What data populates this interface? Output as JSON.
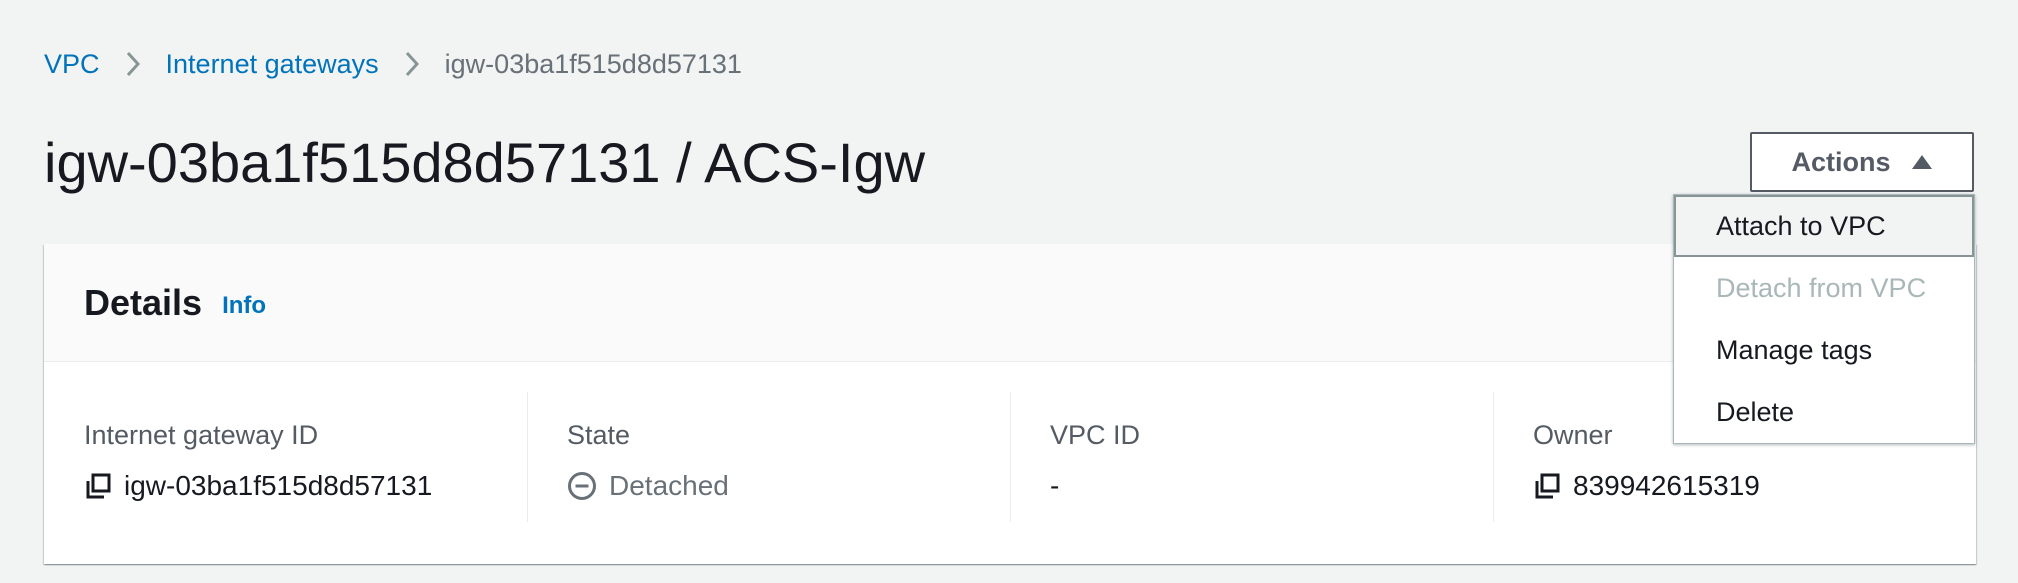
{
  "breadcrumb": {
    "items": [
      {
        "label": "VPC"
      },
      {
        "label": "Internet gateways"
      },
      {
        "label": "igw-03ba1f515d8d57131"
      }
    ]
  },
  "page": {
    "title": "igw-03ba1f515d8d57131 / ACS-Igw"
  },
  "actions": {
    "label": "Actions",
    "menu": [
      {
        "label": "Attach to VPC",
        "state": "highlighted"
      },
      {
        "label": "Detach from VPC",
        "state": "disabled"
      },
      {
        "label": "Manage tags",
        "state": "enabled"
      },
      {
        "label": "Delete",
        "state": "enabled"
      }
    ]
  },
  "details": {
    "title": "Details",
    "info_link": "Info",
    "columns": [
      {
        "label": "Internet gateway ID",
        "value": "igw-03ba1f515d8d57131",
        "icon": "copy-icon"
      },
      {
        "label": "State",
        "value": "Detached",
        "icon": "minus-circle-icon"
      },
      {
        "label": "VPC ID",
        "value": "-"
      },
      {
        "label": "Owner",
        "value": "839942615319",
        "icon": "copy-icon"
      }
    ]
  },
  "colors": {
    "link": "#0073bb",
    "background": "#f2f3f3",
    "text": "#16191f",
    "muted": "#687078",
    "disabled": "#aab7b8"
  }
}
